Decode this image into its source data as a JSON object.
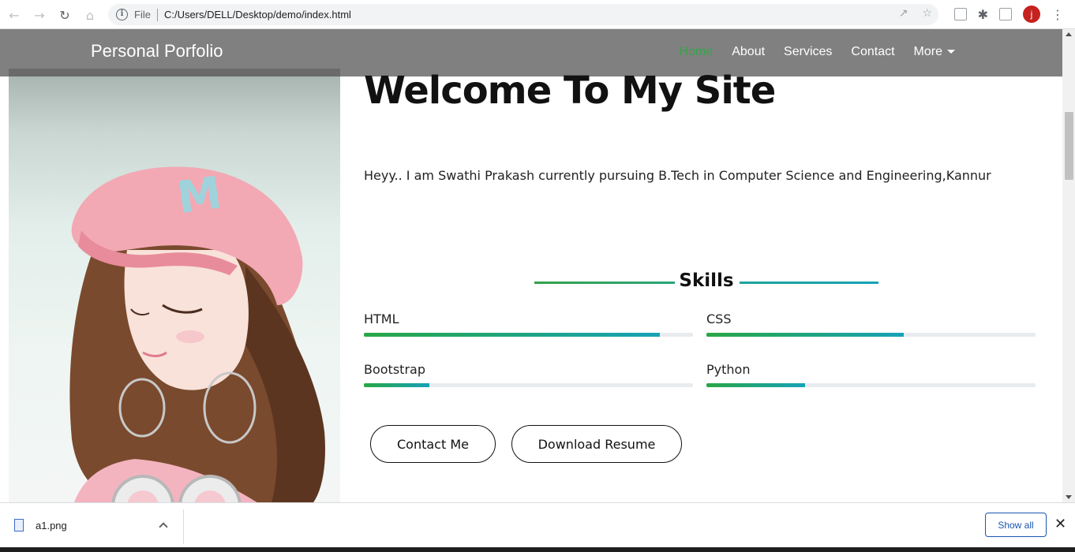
{
  "browser": {
    "file_label": "File",
    "url": "C:/Users/DELL/Desktop/demo/index.html",
    "profile_initial": "j"
  },
  "navbar": {
    "brand": "Personal Porfolio",
    "links": [
      {
        "label": "Home",
        "active": true
      },
      {
        "label": "About"
      },
      {
        "label": "Services"
      },
      {
        "label": "Contact"
      },
      {
        "label": "More"
      }
    ]
  },
  "hero": {
    "title": "Welcome To My Site",
    "intro": "Heyy.. I am Swathi Prakash currently pursuing B.Tech in Computer Science and Engineering,Kannur"
  },
  "skills": {
    "heading": "Skills",
    "items": [
      {
        "name": "HTML",
        "level": 0.9
      },
      {
        "name": "CSS",
        "level": 0.6
      },
      {
        "name": "Bootstrap",
        "level": 0.2
      },
      {
        "name": "Python",
        "level": 0.3
      }
    ]
  },
  "buttons": {
    "contact": "Contact Me",
    "resume": "Download Resume"
  },
  "download_bar": {
    "file_name": "a1.png",
    "show_all": "Show all"
  },
  "colors": {
    "nav_active": "#3aa14a",
    "bar_start": "#28a745",
    "bar_end": "#17a2b8"
  }
}
